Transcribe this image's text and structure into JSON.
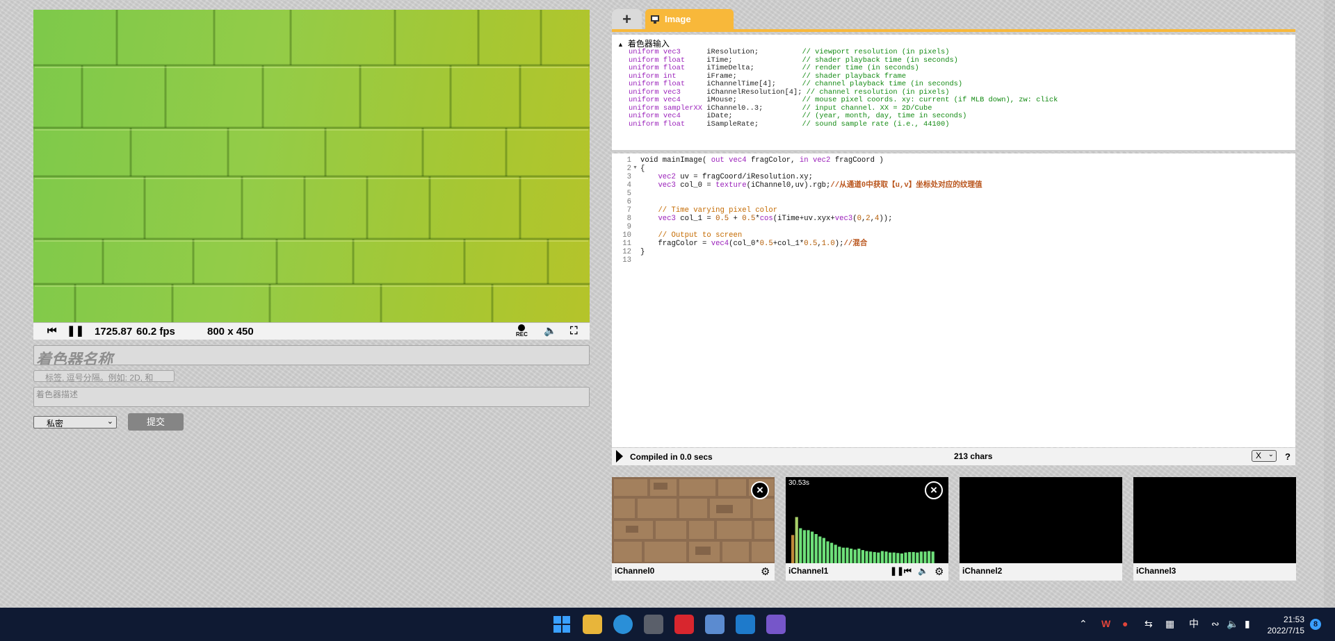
{
  "playbar": {
    "time": "1725.87",
    "fps": "60.2 fps",
    "resolution": "800 x 450",
    "rec_label": "REC"
  },
  "form": {
    "name_placeholder": "着色器名称",
    "tags_placeholder": "标签, 逗号分隔。例如: 2D, 和",
    "description_placeholder": "着色器描述",
    "privacy_value": "私密",
    "submit_label": "提交"
  },
  "tabs": {
    "add_label": "+",
    "image_label": "Image"
  },
  "uniforms": {
    "header": "着色器输入",
    "lines": [
      {
        "kw": "uniform vec3      ",
        "name": "iResolution;          ",
        "comment": "// viewport resolution (in pixels)"
      },
      {
        "kw": "uniform float     ",
        "name": "iTime;                ",
        "comment": "// shader playback time (in seconds)"
      },
      {
        "kw": "uniform float     ",
        "name": "iTimeDelta;           ",
        "comment": "// render time (in seconds)"
      },
      {
        "kw": "uniform int       ",
        "name": "iFrame;               ",
        "comment": "// shader playback frame"
      },
      {
        "kw": "uniform float     ",
        "name": "iChannelTime[4];      ",
        "comment": "// channel playback time (in seconds)"
      },
      {
        "kw": "uniform vec3      ",
        "name": "iChannelResolution[4];",
        "comment": " // channel resolution (in pixels)"
      },
      {
        "kw": "uniform vec4      ",
        "name": "iMouse;               ",
        "comment": "// mouse pixel coords. xy: current (if MLB down), zw: click"
      },
      {
        "kw": "uniform samplerXX ",
        "name": "iChannel0..3;         ",
        "comment": "// input channel. XX = 2D/Cube"
      },
      {
        "kw": "uniform vec4      ",
        "name": "iDate;                ",
        "comment": "// (year, month, day, time in seconds)"
      },
      {
        "kw": "uniform float     ",
        "name": "iSampleRate;          ",
        "comment": "// sound sample rate (i.e., 44100)"
      }
    ]
  },
  "code": {
    "line_numbers": [
      "1",
      "2",
      "3",
      "4",
      "5",
      "6",
      "7",
      "8",
      "9",
      "10",
      "11",
      "12",
      "13"
    ],
    "lines": [
      "void mainImage( out vec4 fragColor, in vec2 fragCoord )",
      "{",
      "    vec2 uv = fragCoord/iResolution.xy;",
      "    vec3 col_0 = texture(iChannel0,uv).rgb;//从通道0中获取【u,v】坐标处对应的纹理值",
      "",
      "",
      "    // Time varying pixel color",
      "    vec3 col_1 = 0.5 + 0.5*cos(iTime+uv.xyx+vec3(0,2,4));",
      "",
      "    // Output to screen",
      "    fragColor = vec4(col_0*0.5+col_1*0.5,1.0);//混合",
      "}",
      ""
    ]
  },
  "status": {
    "compiled": "Compiled in 0.0 secs",
    "chars": "213 chars",
    "font_select": "X",
    "help": "?"
  },
  "channels": {
    "c0": {
      "label": "iChannel0"
    },
    "c1": {
      "label": "iChannel1",
      "time": "30.53s",
      "bars": [
        0.58,
        0.95,
        0.72,
        0.68,
        0.68,
        0.65,
        0.6,
        0.55,
        0.52,
        0.45,
        0.42,
        0.38,
        0.34,
        0.32,
        0.32,
        0.3,
        0.28,
        0.3,
        0.27,
        0.25,
        0.24,
        0.23,
        0.22,
        0.25,
        0.24,
        0.22,
        0.22,
        0.21,
        0.2,
        0.22,
        0.23,
        0.23,
        0.22,
        0.24,
        0.24,
        0.25,
        0.24
      ]
    },
    "c2": {
      "label": "iChannel2"
    },
    "c3": {
      "label": "iChannel3"
    }
  },
  "taskbar": {
    "ime": "中",
    "time": "21:53",
    "date": "2022/7/15",
    "notifications": "8"
  }
}
